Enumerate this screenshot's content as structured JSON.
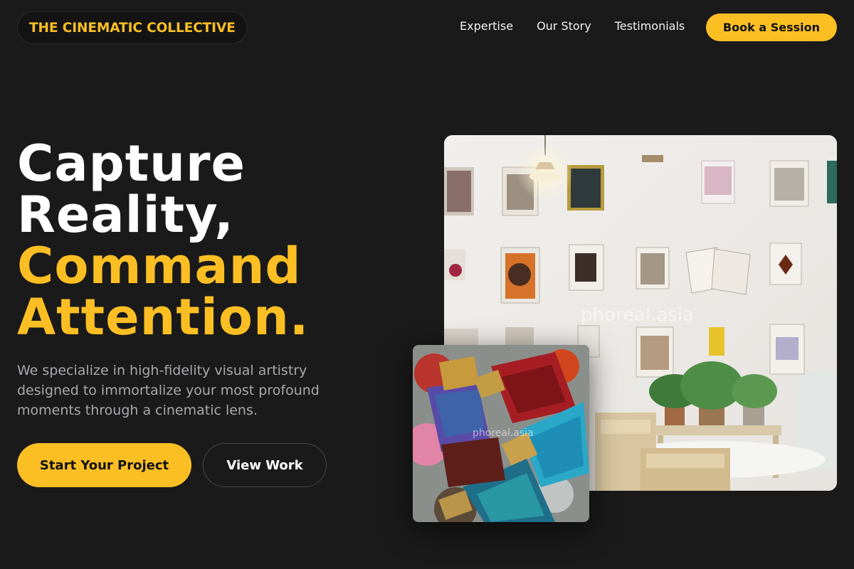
{
  "brand": {
    "name": "THE CINEMATIC COLLECTIVE"
  },
  "nav": {
    "items": [
      {
        "label": "Expertise"
      },
      {
        "label": "Our Story"
      },
      {
        "label": "Testimonials"
      }
    ],
    "cta_label": "Book a Session"
  },
  "hero": {
    "headline_line1": "Capture",
    "headline_line2": "Reality,",
    "headline_line3": "Command",
    "headline_line4": "Attention.",
    "subtext": "We specialize in high-fidelity visual artistry designed to immortalize your most profound moments through a cinematic lens.",
    "primary_label": "Start Your Project",
    "secondary_label": "View Work"
  },
  "images": {
    "main_watermark": "phoreal.asia",
    "small_watermark": "phoreal.asia"
  },
  "colors": {
    "background": "#1b1a1a",
    "accent": "#fbbf24",
    "muted_text": "#a9a9ad"
  }
}
